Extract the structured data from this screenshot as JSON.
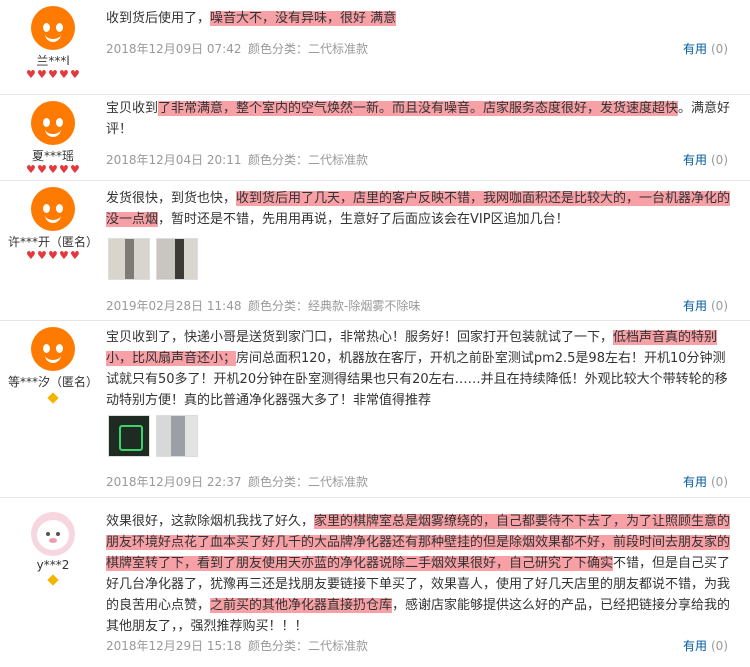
{
  "useful_label": "有用",
  "useful_count": "(0)",
  "color_label": "颜色分类：",
  "reviews": [
    {
      "user": "兰***l",
      "rank_icon": "heart",
      "rank_count": 5,
      "avatar": "orange-mascot",
      "text_plain_1": "收到货后使用了，",
      "text_hl_1": "噪音大不，没有异味，很好 满意",
      "text_plain_2": "",
      "text_hl_2": "",
      "text_plain_3": "",
      "date": "2018年12月09日 07:42",
      "color_value": "二代标准款",
      "images": []
    },
    {
      "user": "夏***瑶",
      "rank_icon": "heart",
      "rank_count": 5,
      "avatar": "orange-mascot",
      "text_plain_1": "宝贝收到",
      "text_hl_1": "了非常满意，整个室内的空气焕然一新。而且没有噪音。店家服务态度很好，发货速度超快",
      "text_plain_2": "。满意好评！",
      "text_hl_2": "",
      "text_plain_3": "",
      "date": "2018年12月04日 20:11",
      "color_value": "二代标准款",
      "images": []
    },
    {
      "user": "许***开（匿名）",
      "rank_icon": "heart",
      "rank_count": 5,
      "avatar": "orange-mascot",
      "text_plain_1": "发货很快，到货也快，",
      "text_hl_1": "收到货后用了几天，店里的客户反映不错，我网咖面积还是比较大的，一台机器净化的没一点烟",
      "text_plain_2": "，暂时还是不错，先用用再说，生意好了后面应该会在VIP区追加几台！",
      "text_hl_2": "",
      "text_plain_3": "",
      "date": "2019年02月28日 11:48",
      "color_value": "经典款-除烟雾不除味",
      "images": [
        "photo-unit-1",
        "photo-unit-2"
      ]
    },
    {
      "user": "等***汐（匿名）",
      "rank_icon": "diamond",
      "rank_count": 1,
      "avatar": "orange-mascot",
      "text_plain_1": "宝贝收到了，快递小哥是送货到家门口，非常热心！服务好！回家打开包装就试了一下，",
      "text_hl_1": "低档声音真的特别小，比风扇声音还小；",
      "text_plain_2": "房间总面积120，机器放在客厅，开机之前卧室测试pm2.5是98左右！开机10分钟测试就只有50多了！开机20分钟在卧室测得结果也只有20左右……并且在持续降低！外观比较大个带转轮的移动特别方便！真的比普通净化器强大多了！非常值得推荐",
      "text_hl_2": "",
      "text_plain_3": "",
      "date": "2018年12月09日 22:37",
      "color_value": "二代标准款",
      "images": [
        "photo-display",
        "photo-unit-3"
      ]
    },
    {
      "user": "y***2",
      "rank_icon": "diamond",
      "rank_count": 1,
      "avatar": "pink-pig",
      "text_plain_1": "效果很好，这款除烟机我找了好久，",
      "text_hl_1": "家里的棋牌室总是烟雾缭绕的，自己都要待不下去了，为了让照顾生意的朋友环境好点花了血本买了好几千的大品牌净化器还有那种壁挂的但是除烟效果都不好，前段时间去朋友家的棋牌室转了下，看到了朋友使用天亦蓝的净化器说除二手烟效果很好，自己研究了下确实",
      "text_plain_2": "不错，但是自己买了好几台净化器了，犹豫再三还是找朋友要链接下单买了，效果喜人，使用了好几天店里的朋友都说不错，为我的良苦用心点赞，",
      "text_hl_2": "之前买的其他净化器直接扔仓库",
      "text_plain_3": "，感谢店家能够提供这么好的产品，已经把链接分享给我的其他朋友了，，强烈推荐购买！！！",
      "date": "2018年12月29日 15:18",
      "color_value": "二代标准款",
      "images": []
    }
  ]
}
